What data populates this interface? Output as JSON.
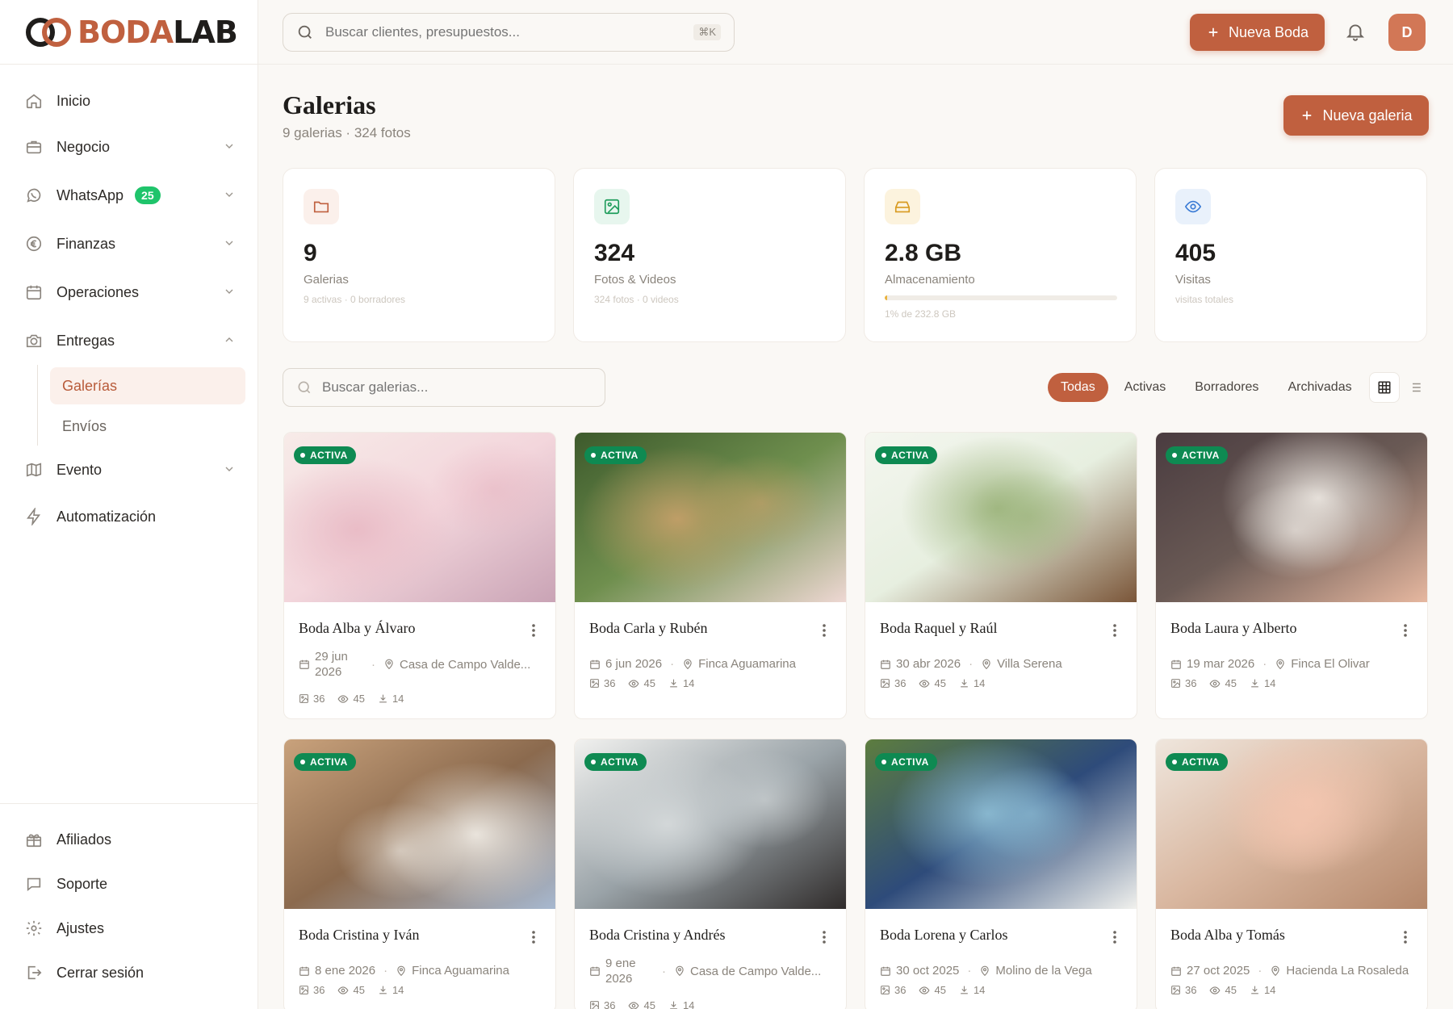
{
  "logo": {
    "part1": "BODA",
    "part2": "LAB"
  },
  "sidebar": {
    "items": [
      {
        "label": "Inicio",
        "icon": "home-icon"
      },
      {
        "label": "Negocio",
        "icon": "briefcase-icon"
      },
      {
        "label": "WhatsApp",
        "icon": "whatsapp-icon",
        "badge": "25"
      },
      {
        "label": "Finanzas",
        "icon": "euro-icon"
      },
      {
        "label": "Operaciones",
        "icon": "calendar-icon"
      },
      {
        "label": "Entregas",
        "icon": "camera-icon"
      },
      {
        "label": "Evento",
        "icon": "map-icon"
      },
      {
        "label": "Automatización",
        "icon": "bolt-icon"
      }
    ],
    "sub_items": [
      {
        "label": "Galerías"
      },
      {
        "label": "Envíos"
      }
    ],
    "bottom": [
      {
        "label": "Afiliados",
        "icon": "gift-icon"
      },
      {
        "label": "Soporte",
        "icon": "chat-icon"
      },
      {
        "label": "Ajustes",
        "icon": "gear-icon"
      },
      {
        "label": "Cerrar sesión",
        "icon": "logout-icon"
      }
    ]
  },
  "topbar": {
    "search_placeholder": "Buscar clientes, presupuestos...",
    "shortcut": "⌘K",
    "new_wedding": "Nueva Boda",
    "avatar_initial": "D"
  },
  "main": {
    "title": "Galerias",
    "subtitle": "9 galerias · 324 fotos",
    "new_gallery": "Nueva galeria",
    "stats": [
      {
        "value": "9",
        "label": "Galerias",
        "detail": "9 activas · 0 borradores",
        "icon": "folder-icon",
        "color": "#c0603f",
        "bg": "#fbf0eb"
      },
      {
        "value": "324",
        "label": "Fotos & Videos",
        "detail": "324 fotos · 0 videos",
        "icon": "image-icon",
        "color": "#1f9d5c",
        "bg": "#e7f6ee"
      },
      {
        "value": "2.8 GB",
        "label": "Almacenamiento",
        "detail": "1% de 232.8 GB",
        "icon": "drive-icon",
        "color": "#d89a20",
        "bg": "#fcf3de",
        "progress": 0.01
      },
      {
        "value": "405",
        "label": "Visitas",
        "detail": "visitas totales",
        "icon": "eye-icon",
        "color": "#3a7bd5",
        "bg": "#e9f1fb"
      }
    ],
    "gallery_search_placeholder": "Buscar galerias...",
    "filters": [
      "Todas",
      "Activas",
      "Borradores",
      "Archivadas"
    ],
    "active_filter": "Todas"
  },
  "galleries": [
    {
      "title": "Boda Alba y Álvaro",
      "date": "29 jun 2026",
      "location": "Casa de Campo Valde...",
      "status": "ACTIVA",
      "photos": "36",
      "views": "45",
      "downloads": "14",
      "palette": [
        "#f3d6dc",
        "#e8b9c4",
        "#c9a3b5",
        "#f7ebe8"
      ]
    },
    {
      "title": "Boda Carla y Rubén",
      "date": "6 jun 2026",
      "location": "Finca Aguamarina",
      "status": "ACTIVA",
      "photos": "36",
      "views": "45",
      "downloads": "14",
      "palette": [
        "#6f8f4e",
        "#c8a06a",
        "#efd8d4",
        "#3d5a2c"
      ]
    },
    {
      "title": "Boda Raquel y Raúl",
      "date": "30 abr 2026",
      "location": "Villa Serena",
      "status": "ACTIVA",
      "photos": "36",
      "views": "45",
      "downloads": "14",
      "palette": [
        "#e7efe0",
        "#9bb37a",
        "#7a5538",
        "#f4f6ef"
      ]
    },
    {
      "title": "Boda Laura y Alberto",
      "date": "19 mar 2026",
      "location": "Finca El Olivar",
      "status": "ACTIVA",
      "photos": "36",
      "views": "45",
      "downloads": "14",
      "palette": [
        "#6a5a55",
        "#f1ece6",
        "#e7b8a0",
        "#4a3c40"
      ]
    },
    {
      "title": "Boda Cristina y Iván",
      "date": "8 ene 2026",
      "location": "Finca Aguamarina",
      "status": "ACTIVA",
      "photos": "36",
      "views": "45",
      "downloads": "14",
      "palette": [
        "#8b6a4e",
        "#f3efe8",
        "#a7b9d1",
        "#c9a27c"
      ]
    },
    {
      "title": "Boda Cristina y Andrés",
      "date": "9 ene 2026",
      "location": "Casa de Campo Valde...",
      "status": "ACTIVA",
      "photos": "36",
      "views": "45",
      "downloads": "14",
      "palette": [
        "#9aa3a8",
        "#d8dcdd",
        "#2f2b2a",
        "#f1f1ef"
      ]
    },
    {
      "title": "Boda Lorena y Carlos",
      "date": "30 oct 2025",
      "location": "Molino de la Vega",
      "status": "ACTIVA",
      "photos": "36",
      "views": "45",
      "downloads": "14",
      "palette": [
        "#2e4b7a",
        "#8fbfd6",
        "#f2f2ee",
        "#5d7d3f"
      ]
    },
    {
      "title": "Boda Alba y Tomás",
      "date": "27 oct 2025",
      "location": "Hacienda La Rosaleda",
      "status": "ACTIVA",
      "photos": "36",
      "views": "45",
      "downloads": "14",
      "palette": [
        "#d9b7a0",
        "#f4c6b0",
        "#b4876a",
        "#efe6dd"
      ]
    }
  ]
}
